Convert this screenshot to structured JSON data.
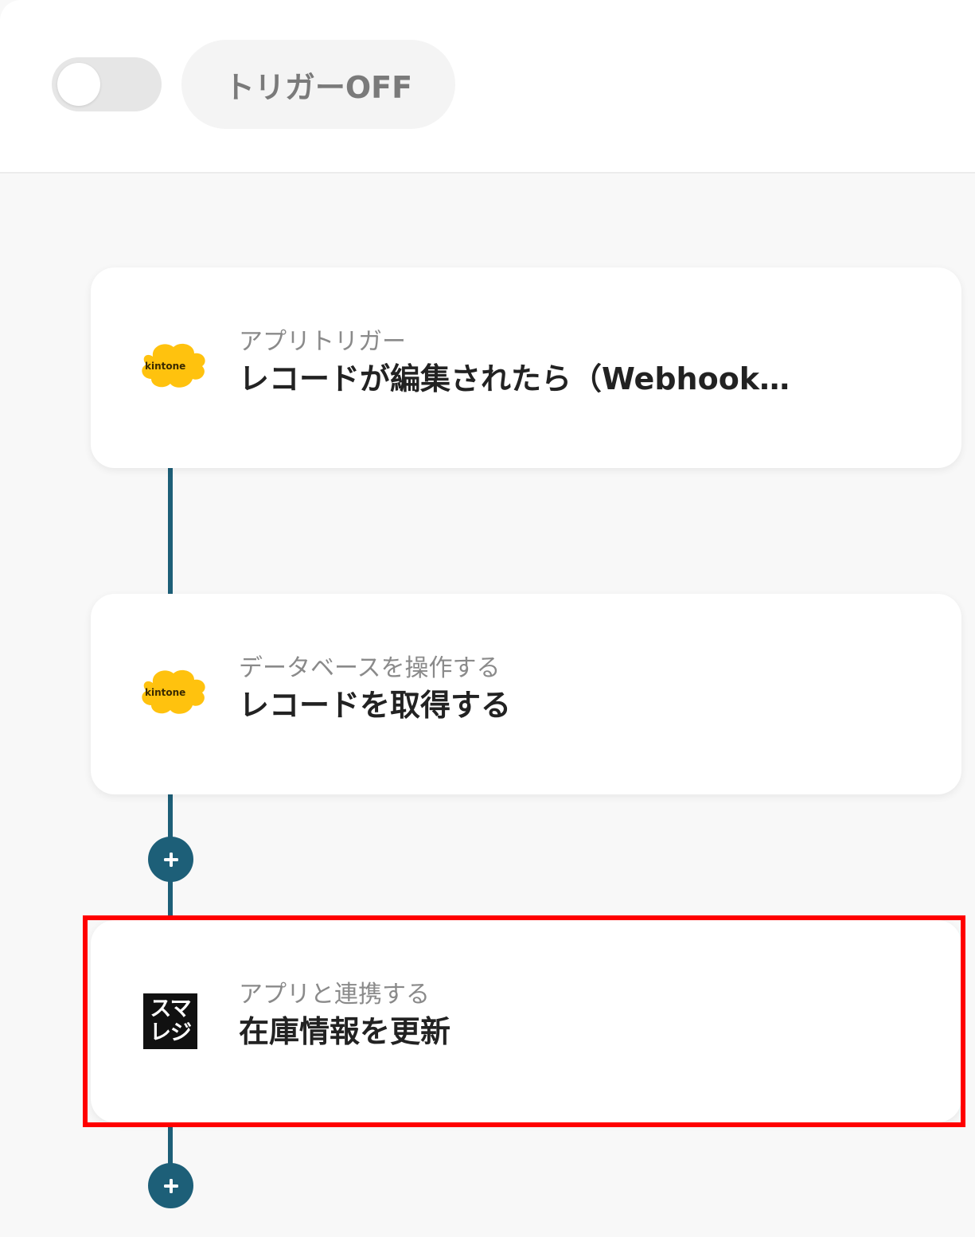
{
  "header": {
    "trigger_toggle_state": "off",
    "trigger_label": "トリガーOFF"
  },
  "steps": [
    {
      "app_icon": "kintone-logo",
      "icon_text": "kintone",
      "category": "アプリトリガー",
      "title": "レコードが編集されたら（Webhook…"
    },
    {
      "app_icon": "kintone-logo",
      "icon_text": "kintone",
      "category": "データベースを操作する",
      "title": "レコードを取得する"
    },
    {
      "app_icon": "smaregi-logo",
      "icon_text_line1": "スマ",
      "icon_text_line2": "レジ",
      "category": "アプリと連携する",
      "title": "在庫情報を更新",
      "highlighted": true
    }
  ],
  "colors": {
    "connector": "#1d5f78",
    "kintone_yellow": "#ffc20e",
    "highlight_border": "#ff0000"
  }
}
